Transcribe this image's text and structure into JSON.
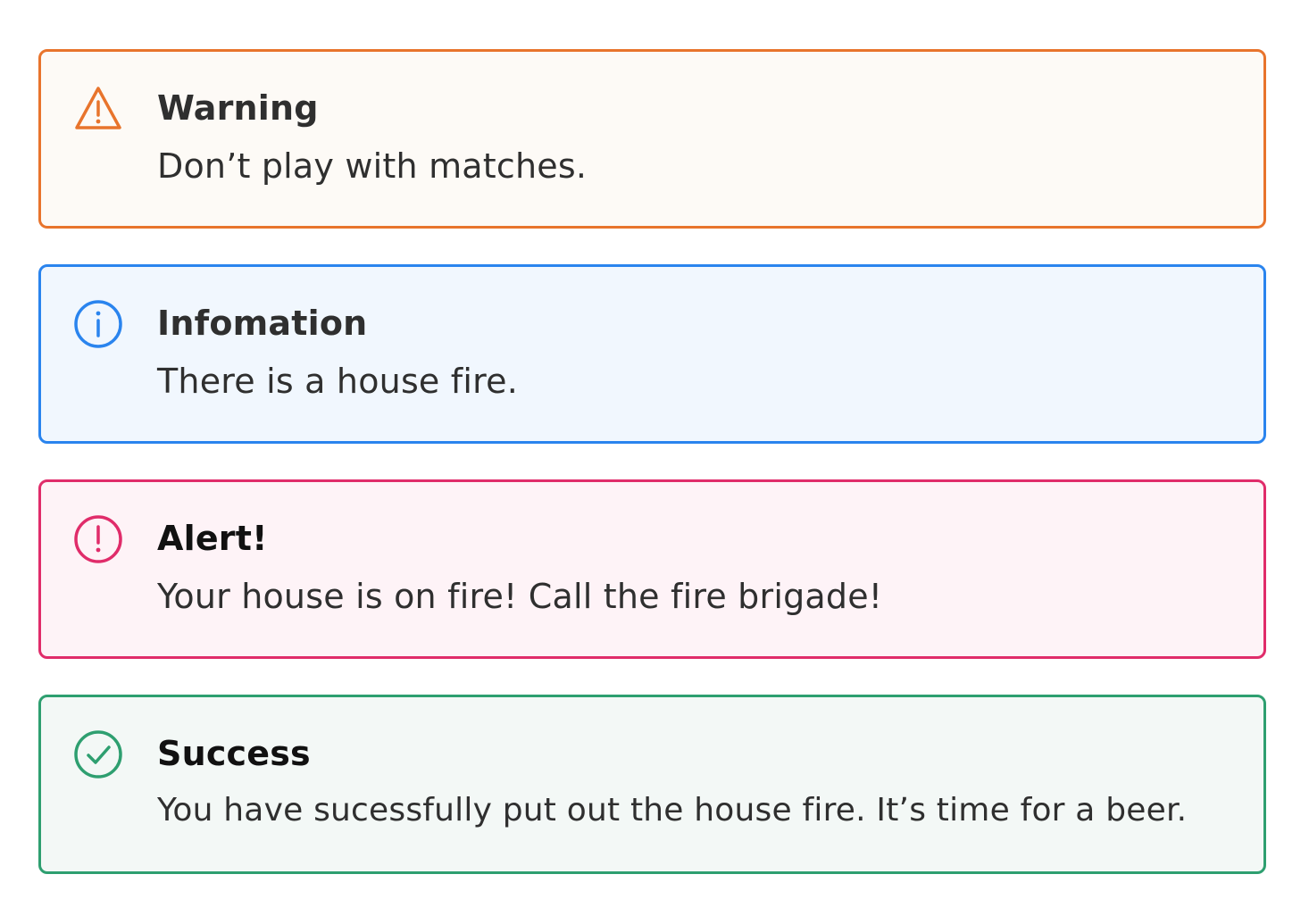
{
  "alerts": {
    "warning": {
      "title": "Warning",
      "message": "Don’t play with matches.",
      "icon": "warning-triangle-icon",
      "color": "#e8742c",
      "background": "#fdfaf6"
    },
    "info": {
      "title": "Infomation",
      "message": "There is a house fire.",
      "icon": "info-circle-icon",
      "color": "#2a84ee",
      "background": "#f1f7fe"
    },
    "alert": {
      "title": "Alert!",
      "message": "Your house is on fire! Call the fire brigade!",
      "icon": "exclamation-circle-icon",
      "color": "#e02c6a",
      "background": "#fef3f7"
    },
    "success": {
      "title": "Success",
      "message": "You have sucessfully put out the house fire. It’s time for a beer.",
      "icon": "check-circle-icon",
      "color": "#2e9f70",
      "background": "#f3f8f6"
    }
  }
}
